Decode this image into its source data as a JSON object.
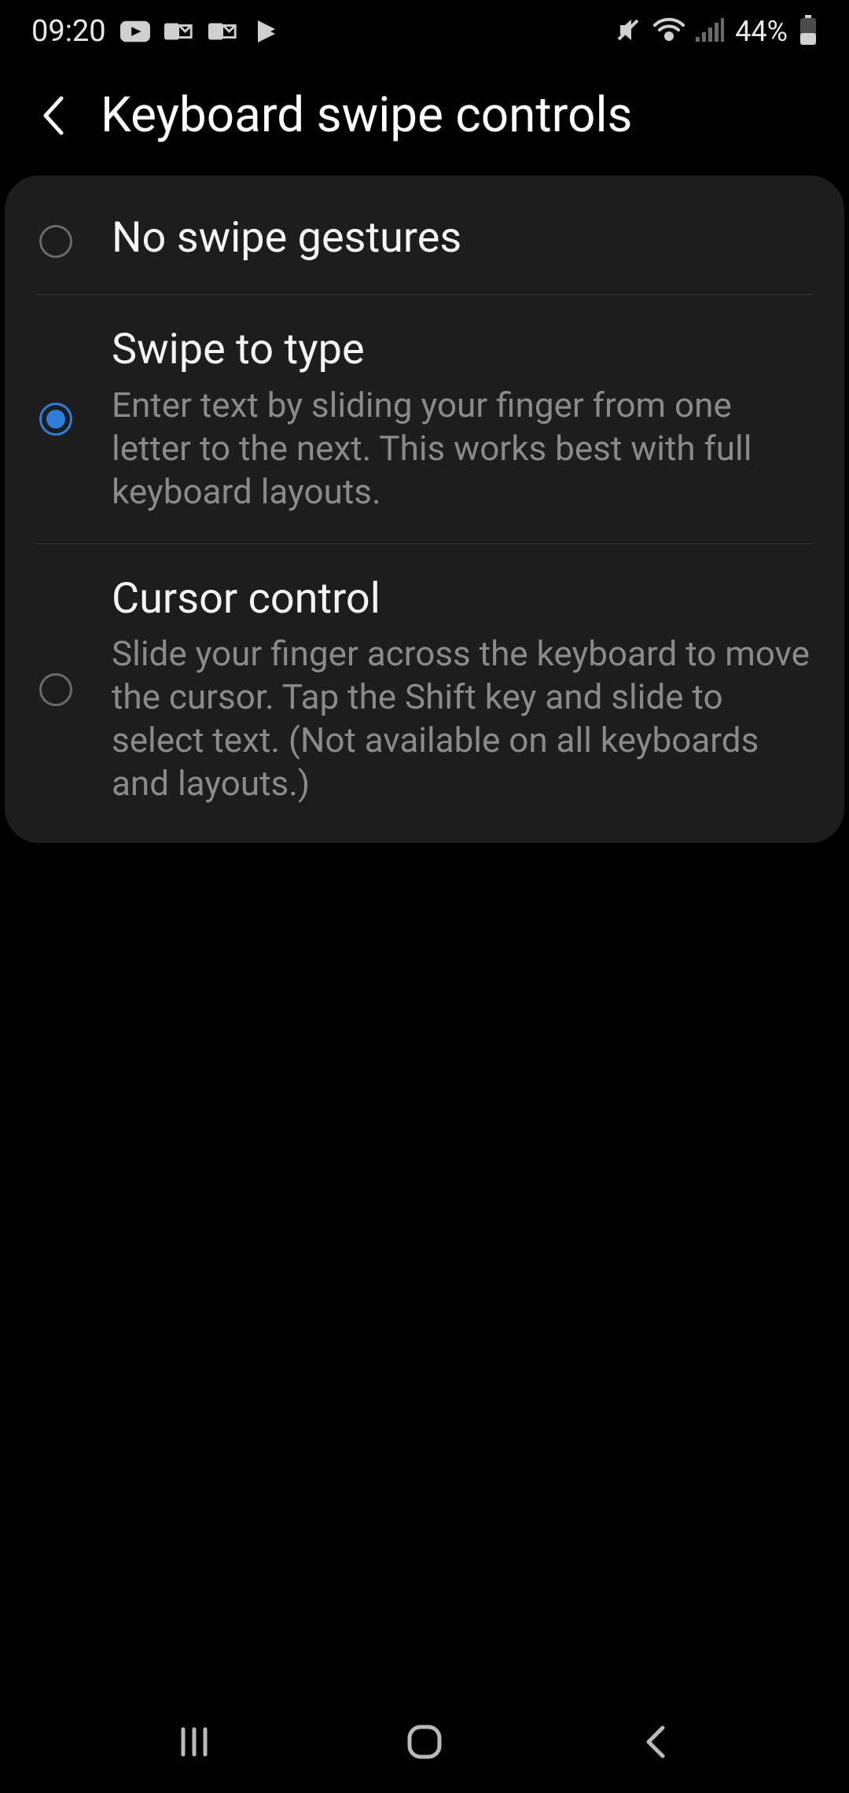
{
  "statusBar": {
    "time": "09:20",
    "batteryPercent": "44%"
  },
  "header": {
    "title": "Keyboard swipe controls"
  },
  "options": [
    {
      "title": "No swipe gestures",
      "description": "",
      "selected": false
    },
    {
      "title": "Swipe to type",
      "description": "Enter text by sliding your finger from one letter to the next. This works best with full keyboard layouts.",
      "selected": true
    },
    {
      "title": "Cursor control",
      "description": "Slide your finger across the keyboard to move the cursor. Tap the Shift key and slide to select text. (Not available on all keyboards and layouts.)",
      "selected": false
    }
  ]
}
